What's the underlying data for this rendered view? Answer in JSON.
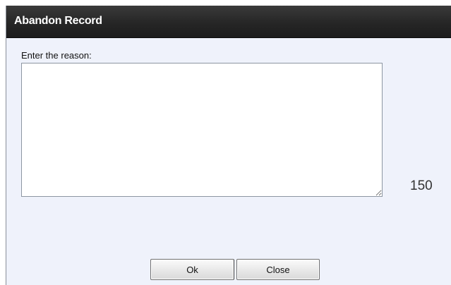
{
  "dialog": {
    "title": "Abandon Record",
    "prompt_label": "Enter the reason:",
    "reason_value": "",
    "char_counter": "150",
    "ok_label": "Ok",
    "close_label": "Close"
  }
}
